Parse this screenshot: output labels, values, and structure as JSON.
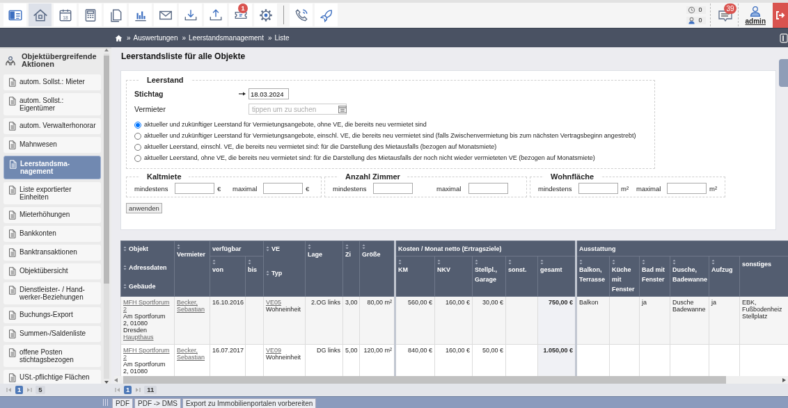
{
  "toolbar": {
    "items": [
      {
        "kind": "card",
        "selected": false
      },
      {
        "kind": "home",
        "selected": true
      },
      {
        "kind": "calendar",
        "selected": false,
        "day": "18"
      },
      {
        "kind": "calculator",
        "selected": false
      },
      {
        "kind": "copy",
        "selected": false
      },
      {
        "kind": "chart",
        "selected": false
      },
      {
        "kind": "mail",
        "selected": false
      },
      {
        "kind": "download",
        "selected": false
      },
      {
        "kind": "upload",
        "selected": false
      },
      {
        "kind": "ticket",
        "selected": false,
        "badge": "1"
      },
      {
        "kind": "gear",
        "selected": false
      },
      {
        "kind": "divider"
      },
      {
        "kind": "phone",
        "selected": false
      },
      {
        "kind": "rocket",
        "selected": false
      }
    ],
    "counters": [
      {
        "kind": "clock",
        "value": "0"
      },
      {
        "kind": "user-clock",
        "value": "0"
      }
    ],
    "messages": {
      "badge": "39"
    },
    "user": {
      "name": "admin"
    }
  },
  "breadcrumb": [
    {
      "separator": "»",
      "label": "Auswertungen"
    },
    {
      "separator": "»",
      "label": "Leerstandsmanagement"
    },
    {
      "separator": "»",
      "label": "Liste"
    }
  ],
  "sidebar": {
    "title": "Objektübergreifende Aktionen",
    "items": [
      {
        "label": "autom. Sollst.: Mieter",
        "selected": false
      },
      {
        "label": "autom. Sollst.: Eigentümer",
        "selected": false
      },
      {
        "label": "autom. Verwalterhonorar",
        "selected": false
      },
      {
        "label": "Mahnwesen",
        "selected": false
      },
      {
        "label": "Leerstandsma-nagement",
        "selected": true
      },
      {
        "label": "Liste exportierter Einheiten",
        "selected": false
      },
      {
        "label": "Mieterhöhungen",
        "selected": false
      },
      {
        "label": "Bankkonten",
        "selected": false
      },
      {
        "label": "Banktransaktionen",
        "selected": false
      },
      {
        "label": "Objektübersicht",
        "selected": false
      },
      {
        "label": "Dienstleister- / Hand-werker-Beziehungen",
        "selected": false
      },
      {
        "label": "Buchungs-Export",
        "selected": false
      },
      {
        "label": "Summen-/Saldenliste",
        "selected": false
      },
      {
        "label": "offene Posten stichtagsbezogen",
        "selected": false
      },
      {
        "label": "USt.-pflichtige Flächen",
        "selected": false
      }
    ],
    "pager": {
      "pages": [
        {
          "label": "1",
          "selected": true
        }
      ],
      "total": "5"
    }
  },
  "page_title": "Leerstandsliste für alle Objekte",
  "filter": {
    "legend": "Leerstand",
    "stichtag": {
      "label": "Stichtag",
      "value": "18.03.2024"
    },
    "vermieter": {
      "label": "Vermieter",
      "placeholder": "tippen um zu suchen"
    },
    "options": [
      {
        "label": "aktueller und zukünftiger Leerstand für Vermietungsangebote, ohne VE, die bereits neu vermietet sind",
        "selected": true
      },
      {
        "label": "aktueller und zukünftiger Leerstand für Vermietungsangebote, einschl. VE, die bereits neu vermietet sind (falls Zwischenvermietung bis zum nächsten Vertragsbeginn angestrebt)",
        "selected": false
      },
      {
        "label": "aktueller Leerstand, einschl. VE, die bereits neu vermietet sind: für die Darstellung des Mietausfalls (bezogen auf Monatsmiete)",
        "selected": false
      },
      {
        "label": "aktueller Leerstand, ohne VE, die bereits neu vermietet sind: für die Darstellung des Mietausfalls der noch nicht wieder vermieteten VE (bezogen auf Monatsmiete)",
        "selected": false
      }
    ],
    "ranges": [
      {
        "legend": "Kaltmiete",
        "min_label": "mindestens",
        "min_unit": "€",
        "max_label": "maximal",
        "max_unit": "€"
      },
      {
        "legend": "Anzahl Zimmer",
        "min_label": "mindestens",
        "max_label": "maximal"
      },
      {
        "legend": "Wohnfläche",
        "min_label": "mindestens",
        "min_unit": "m²",
        "max_label": "maximal",
        "max_unit": "m²"
      }
    ],
    "apply_button": "anwenden"
  },
  "table": {
    "header": [
      {
        "label": "Objekt",
        "sortable": true,
        "more": [
          {
            "label": "Adressdaten",
            "sortable": true
          },
          {
            "label": "Gebäude",
            "sortable": true
          }
        ]
      },
      {
        "label": "Vermieter",
        "sortable": true
      },
      {
        "label": "verfügbar",
        "sortable": false,
        "children": [
          {
            "label": "von",
            "sortable": true
          },
          {
            "label": "bis",
            "sortable": true
          }
        ]
      },
      {
        "label": "VE",
        "sortable": true,
        "more": [
          {
            "label": "Typ",
            "sortable": true
          }
        ]
      },
      {
        "label": "Lage",
        "sortable": true
      },
      {
        "label": "Zi",
        "sortable": true
      },
      {
        "label": "Größe",
        "sortable": true
      },
      {
        "label": "Kosten / Monat netto (Ertragsziele)",
        "sortable": false,
        "children": [
          {
            "label": "KM",
            "sortable": true
          },
          {
            "label": "NKV",
            "sortable": true
          },
          {
            "label": "Stellpl., Garage",
            "sortable": true
          },
          {
            "label": "sonst.",
            "sortable": true
          },
          {
            "label": "gesamt",
            "sortable": true
          }
        ]
      },
      {
        "label": "Ausstattung",
        "sortable": false,
        "children": [
          {
            "label": "Balkon, Terrasse",
            "sortable": true
          },
          {
            "label": "Küche mit Fenster",
            "sortable": true
          },
          {
            "label": "Bad mit Fenster",
            "sortable": true
          },
          {
            "label": "Dusche, Badewanne",
            "sortable": true
          },
          {
            "label": "Aufzug",
            "sortable": true
          },
          {
            "label": "sonstiges",
            "sortable": false
          }
        ]
      }
    ],
    "rows": [
      {
        "cells": [
          [
            {
              "kind": "link",
              "text": "MFH Sportforum 2"
            },
            {
              "kind": "text",
              "text": "Am Sportforum 2, 01080 Dresden"
            },
            {
              "kind": "link",
              "text": "Haupthaus"
            }
          ],
          [
            {
              "kind": "link",
              "text": "Becker, Sebastian"
            }
          ],
          "16.10.2016",
          null,
          [
            {
              "kind": "link",
              "text": "VE05"
            },
            {
              "kind": "text",
              "text": "Wohneinheit"
            }
          ],
          "2.OG links",
          "3,00",
          "80,00 m²",
          "560,00 €",
          "160,00 €",
          "30,00 €",
          null,
          "750,00 €",
          "Balkon",
          null,
          "ja",
          "Dusche Badewanne",
          "ja",
          [
            {
              "kind": "text",
              "text": "EBK, Fußbodenheiz"
            },
            {
              "kind": "text",
              "text": "Stellplatz"
            }
          ]
        ]
      },
      {
        "cells": [
          [
            {
              "kind": "link",
              "text": "MFH Sportforum 2"
            },
            {
              "kind": "text",
              "text": "Am Sportforum 2, 01080"
            }
          ],
          [
            {
              "kind": "link",
              "text": "Becker, Sebastian"
            }
          ],
          "16.07.2017",
          null,
          [
            {
              "kind": "link",
              "text": "VE09"
            },
            {
              "kind": "text",
              "text": "Wohneinheit"
            }
          ],
          "DG links",
          "5,00",
          "120,00 m²",
          "840,00 €",
          "160,00 €",
          "50,00 €",
          null,
          "1.050,00 €",
          null,
          null,
          null,
          null,
          null,
          null
        ]
      }
    ]
  },
  "pager": {
    "pages": [
      {
        "label": "1",
        "selected": true
      }
    ],
    "total": "11"
  },
  "bottom_tabs": [
    "PDF",
    "PDF -> DMS",
    "Export zu Immobilienportalen vorbereiten"
  ]
}
